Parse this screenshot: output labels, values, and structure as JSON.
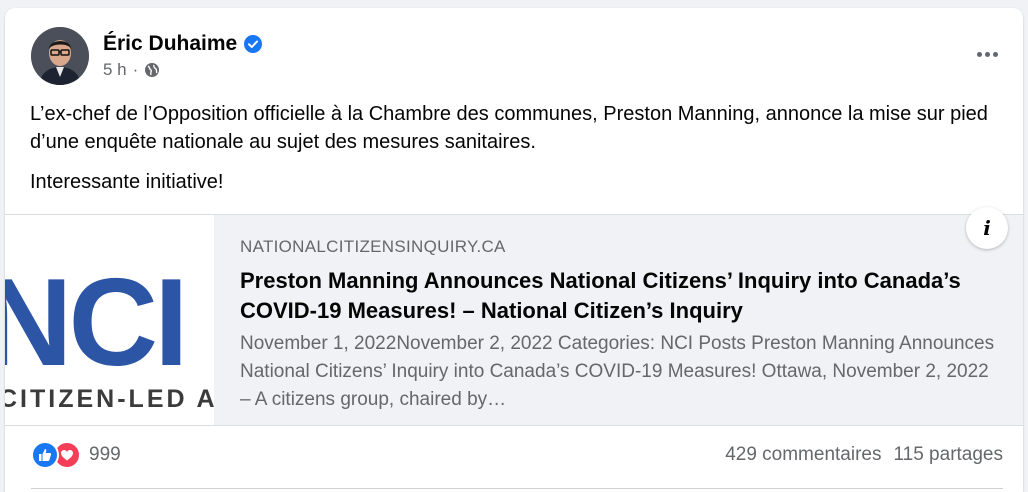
{
  "post": {
    "author": "Éric Duhaime",
    "time": "5 h",
    "meta_separator": "·",
    "privacy_icon": "globe-icon",
    "verified_icon": "verified-badge-icon",
    "text_paragraphs": [
      "L’ex-chef de l’Opposition officielle à la Chambre des communes, Preston Manning, annonce la mise sur pied d’une enquête nationale au sujet des mesures sanitaires.",
      "Interessante initiative!"
    ]
  },
  "link": {
    "domain": "NATIONALCITIZENSINQUIRY.CA",
    "title": "Preston Manning Announces National Citizens’ Inquiry into Canada’s COVID-19 Measures! – National Citizen’s Inquiry",
    "description": "November 1, 2022November 2, 2022 Categories: NCI Posts Preston Manning Announces National Citizens’ Inquiry into Canada’s COVID-19 Measures! Ottawa, November 2, 2022 – A citizens group, chaired by…",
    "thumbnail_logo_text": "NCI",
    "thumbnail_tagline": "CITIZEN-LED A",
    "info_label": "i"
  },
  "stats": {
    "reaction_icons": [
      "like-icon",
      "love-icon"
    ],
    "reaction_count": "999",
    "comments": "429 commentaires",
    "shares": "115 partages"
  },
  "colors": {
    "accent_blue": "#1877f2",
    "love_red": "#f33e58",
    "nci_blue": "#2c55a6",
    "secondary_text": "#65676b"
  }
}
